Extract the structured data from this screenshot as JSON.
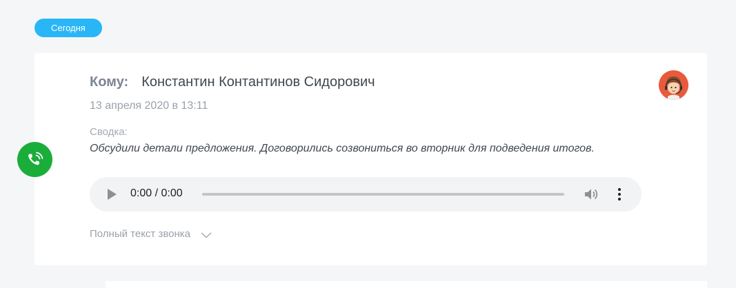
{
  "date_badge": {
    "label": "Сегодня",
    "color": "#29b6f6"
  },
  "call": {
    "icon": "phone-call-icon",
    "icon_color": "#1aad3a",
    "recipient_label": "Кому:",
    "recipient_name": "Константин Контантинов Сидорович",
    "datetime": "13 апреля 2020 в 13:11",
    "summary_label": "Сводка:",
    "summary_text": "Обсудили детали предложения. Договорились созвониться во вторник для подведения итогов.",
    "avatar_icon": "operator-avatar-icon"
  },
  "audio": {
    "time": "0:00 / 0:00",
    "progress": 0,
    "play_icon": "play-icon",
    "volume_icon": "volume-icon",
    "more_icon": "more-vertical-icon"
  },
  "transcript": {
    "label": "Полный текст звонка",
    "icon": "chevron-down-icon"
  }
}
